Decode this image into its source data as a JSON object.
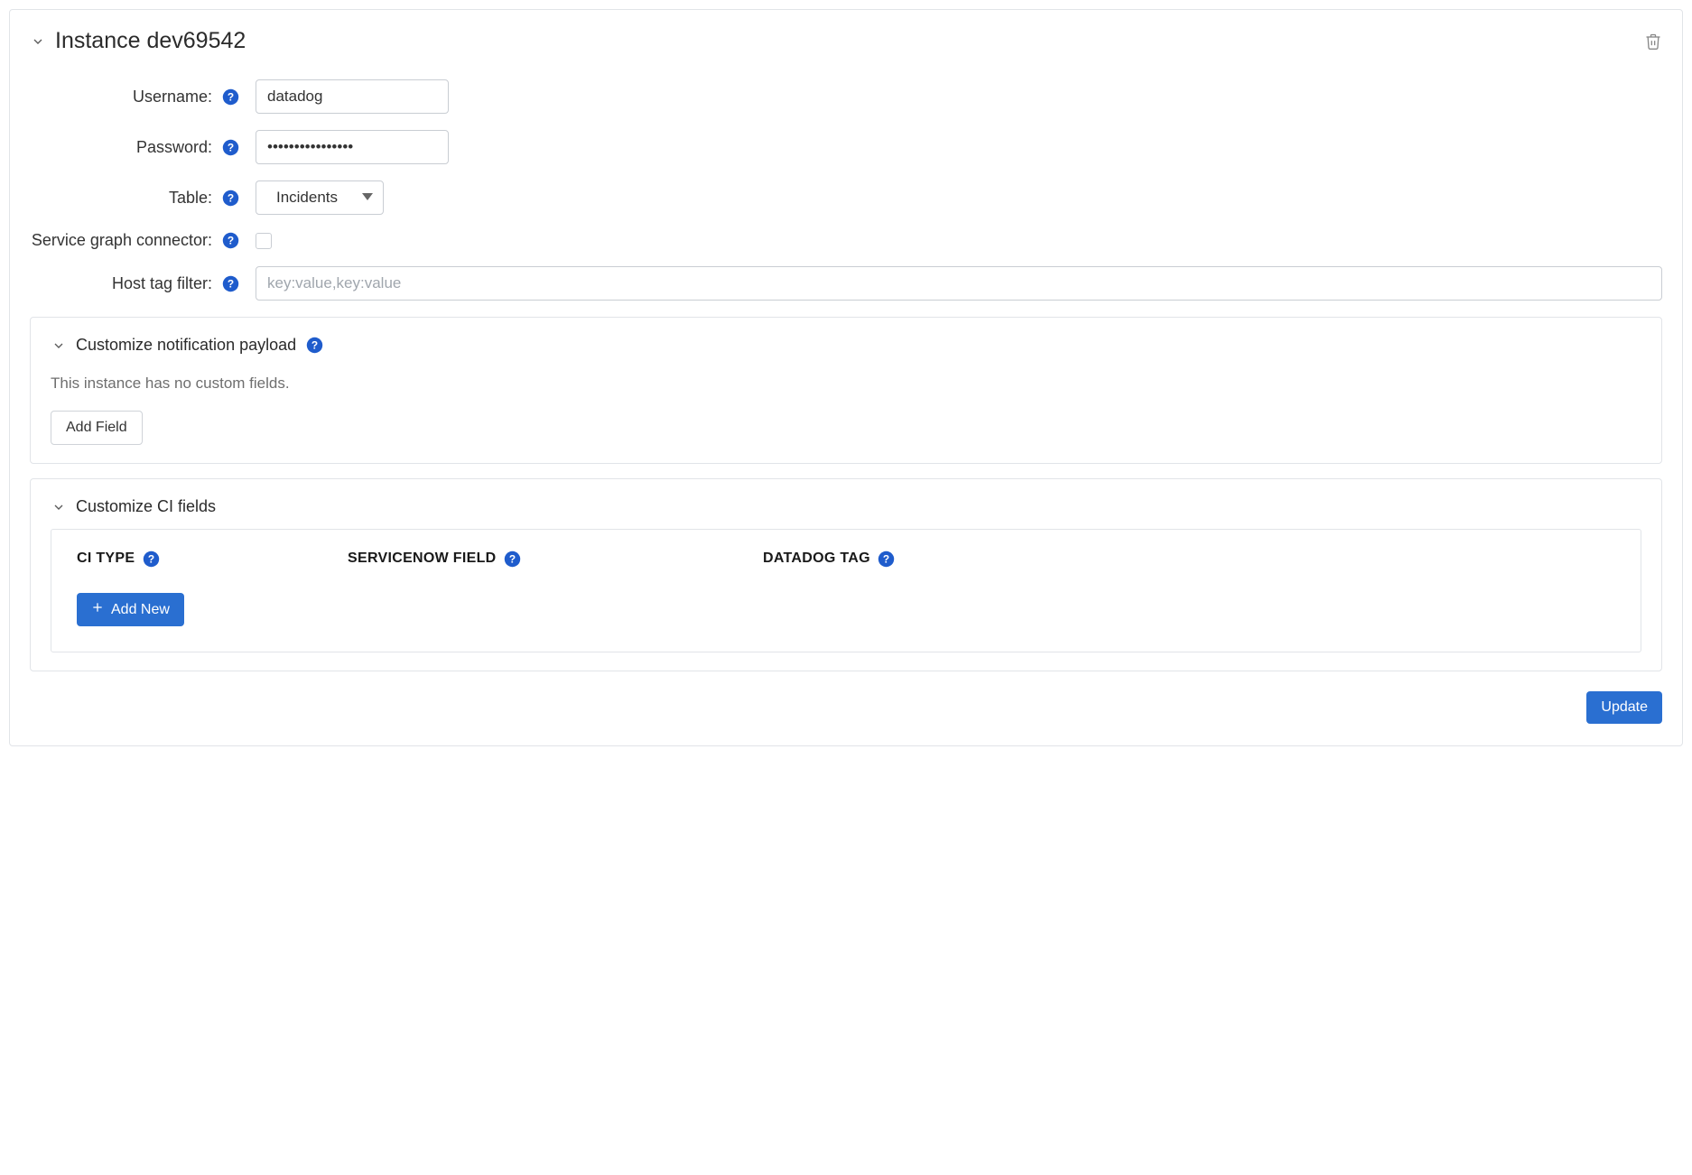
{
  "header": {
    "title": "Instance dev69542"
  },
  "form": {
    "username": {
      "label": "Username:",
      "value": "datadog"
    },
    "password": {
      "label": "Password:",
      "value": "••••••••••••••••"
    },
    "table": {
      "label": "Table:",
      "selected": "Incidents"
    },
    "sgc": {
      "label": "Service graph connector:",
      "checked": false
    },
    "hostTag": {
      "label": "Host tag filter:",
      "placeholder": "key:value,key:value",
      "value": ""
    }
  },
  "customizePayload": {
    "title": "Customize notification payload",
    "emptyText": "This instance has no custom fields.",
    "addFieldLabel": "Add Field"
  },
  "customizeCI": {
    "title": "Customize CI fields",
    "columns": {
      "ciType": "CI TYPE",
      "servicenowField": "SERVICENOW FIELD",
      "datadogTag": "DATADOG TAG"
    },
    "addNewLabel": "Add New"
  },
  "footer": {
    "updateLabel": "Update"
  }
}
